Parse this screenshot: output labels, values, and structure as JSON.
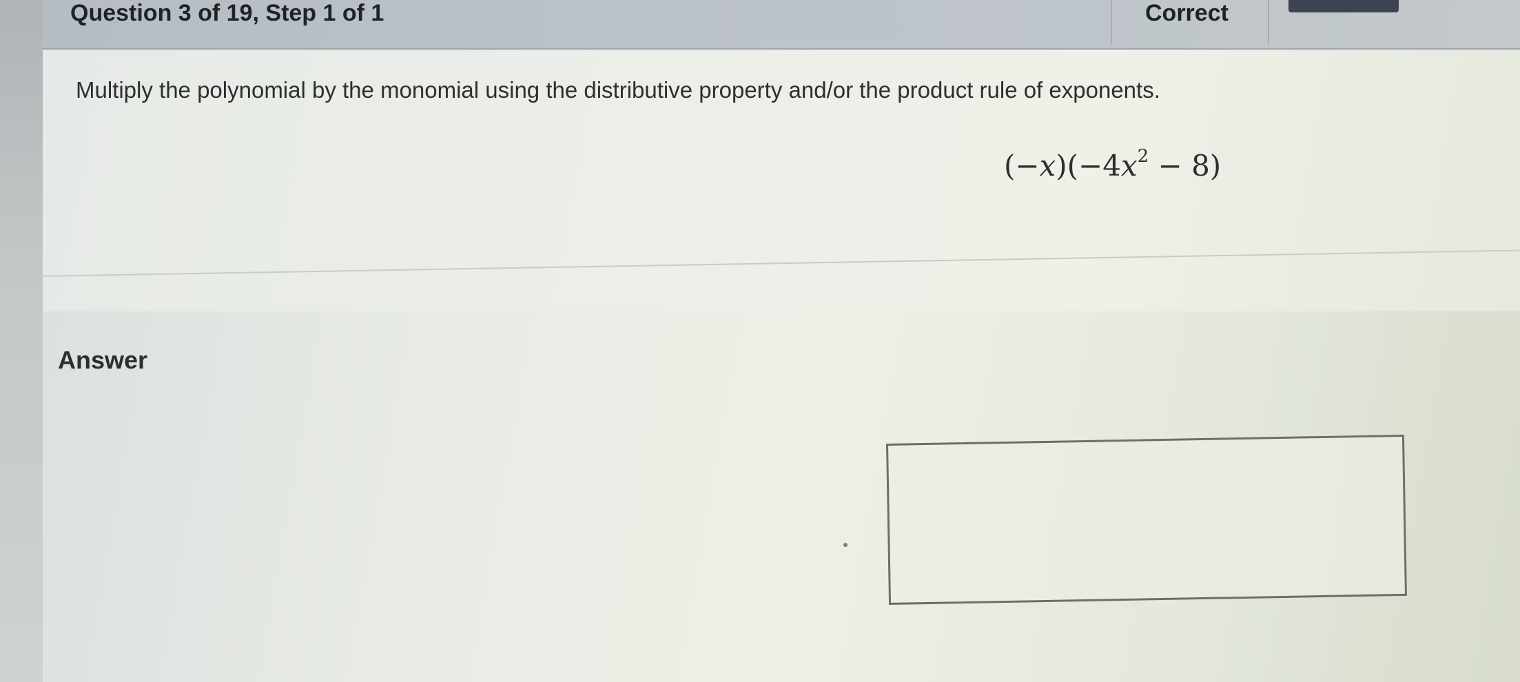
{
  "header": {
    "title": "Question 3 of 19, Step 1 of 1",
    "status": "Correct"
  },
  "question": {
    "prompt": "Multiply the polynomial by the monomial using the distributive property and/or the product rule of exponents.",
    "expression": {
      "open1": "(−",
      "var1": "x",
      "close1": ")(−4",
      "var2": "x",
      "exponent": "2",
      "tail": " − 8)"
    }
  },
  "answer": {
    "label": "Answer",
    "value": ""
  }
}
